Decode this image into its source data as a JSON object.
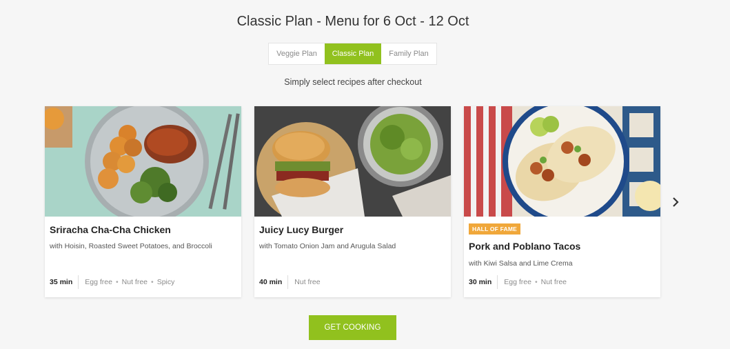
{
  "header": {
    "title": "Classic Plan - Menu for 6 Oct - 12 Oct",
    "subtitle": "Simply select recipes after checkout"
  },
  "plan_tabs": [
    {
      "label": "Veggie Plan",
      "selected": false
    },
    {
      "label": "Classic Plan",
      "selected": true
    },
    {
      "label": "Family Plan",
      "selected": false
    }
  ],
  "recipes": [
    {
      "title": "Sriracha Cha-Cha Chicken",
      "subtitle": "with Hoisin, Roasted Sweet Potatoes, and Broccoli",
      "time": "35 min",
      "tags": [
        "Egg free",
        "Nut free",
        "Spicy"
      ],
      "badge": null
    },
    {
      "title": "Juicy Lucy Burger",
      "subtitle": "with Tomato Onion Jam and Arugula Salad",
      "time": "40 min",
      "tags": [
        "Nut free"
      ],
      "badge": null
    },
    {
      "title": "Pork and Poblano Tacos",
      "subtitle": "with Kiwi Salsa and Lime Crema",
      "time": "30 min",
      "tags": [
        "Egg free",
        "Nut free"
      ],
      "badge": "HALL OF FAME"
    }
  ],
  "carousel": {
    "next_icon": "chevron-right-icon"
  },
  "cta": {
    "label": "GET COOKING"
  },
  "colors": {
    "accent": "#91c11e",
    "badge": "#f0a73a"
  }
}
